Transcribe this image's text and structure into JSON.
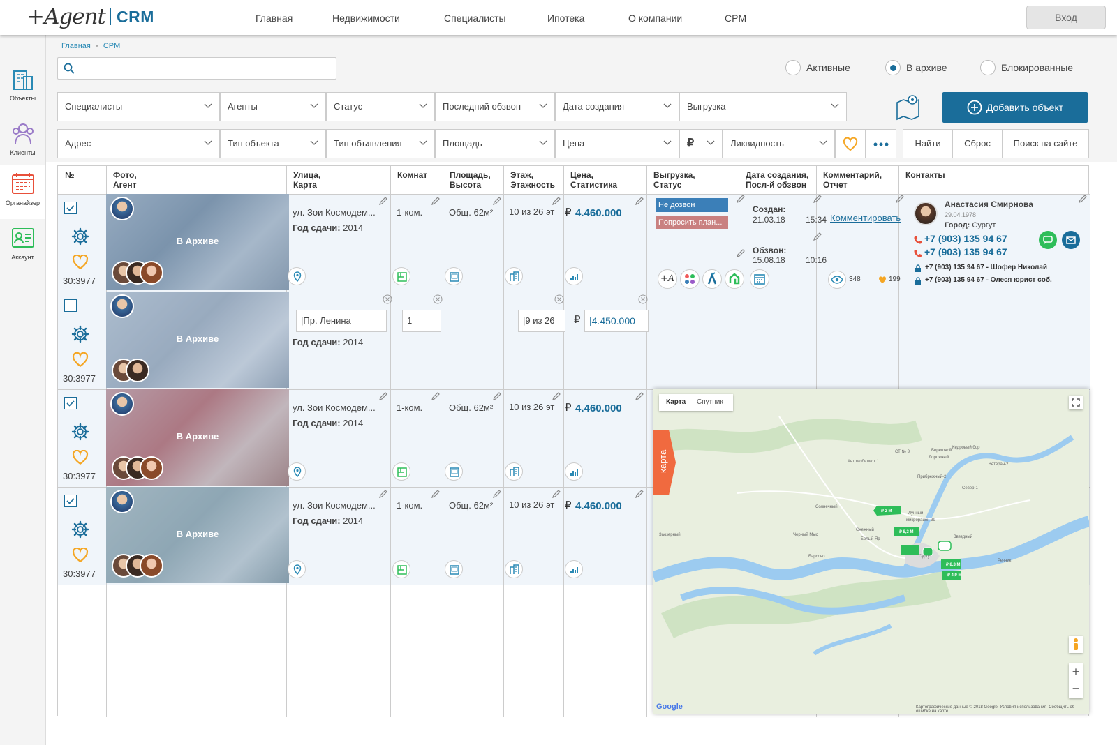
{
  "header": {
    "logo_text": "+Agent",
    "logo_crm": "CRM",
    "nav": [
      "Главная",
      "Недвижимости",
      "Специалисты",
      "Ипотека",
      "О компании",
      "CPM"
    ],
    "login": "Вход"
  },
  "sidebar": [
    {
      "label": "Объекты",
      "icon": "building-icon"
    },
    {
      "label": "Клиенты",
      "icon": "people-icon"
    },
    {
      "label": "Органайзер",
      "icon": "calendar-icon"
    },
    {
      "label": "Аккаунт",
      "icon": "account-icon"
    }
  ],
  "breadcrumb": {
    "home": "Главная",
    "sep": "•",
    "current": "CPM"
  },
  "search": {
    "placeholder": ""
  },
  "status_filter": {
    "options": [
      "Активные",
      "В архиве",
      "Блокированные"
    ],
    "selected": "В архиве"
  },
  "filters_row1": [
    "Специалисты",
    "Агенты",
    "Статус",
    "Последний обзвон",
    "Дата создания",
    "Выгрузка"
  ],
  "filters_row2": [
    "Адрес",
    "Тип объекта",
    "Тип объявления",
    "Площадь",
    "Цена",
    "₽",
    "Ликвидность"
  ],
  "actions": {
    "add": "Добавить объект",
    "find": "Найти",
    "reset": "Сброс",
    "site_search": "Поиск на сайте"
  },
  "table": {
    "headers": [
      [
        "№",
        ""
      ],
      [
        "Фото,",
        "Агент"
      ],
      [
        "Улица,",
        "Карта"
      ],
      [
        "Комнат",
        ""
      ],
      [
        "Площадь,",
        "Высота"
      ],
      [
        "Этаж,",
        "Этажность"
      ],
      [
        "Цена,",
        "Статистика"
      ],
      [
        "Выгрузка,",
        "Статус"
      ],
      [
        "Дата создания,",
        "Посл-й обзвон"
      ],
      [
        "Комментарий,",
        "Отчет"
      ],
      [
        "Контакты",
        ""
      ]
    ],
    "rows": [
      {
        "id": "30:3977",
        "checked": true,
        "photo_label": "В Архиве",
        "street": "ул. Зои Космодем...",
        "year_label": "Год сдачи:",
        "year": "2014",
        "rooms": "1-ком.",
        "area": "Общ. 62м²",
        "floor": "10 из 26 эт",
        "currency": "₽",
        "price": "4.460.000"
      },
      {
        "id": "30:3977",
        "checked": false,
        "photo_label": "В Архиве",
        "street_input": "|Пр. Ленина",
        "year_label": "Год сдачи:",
        "year": "2014",
        "rooms_input": "1",
        "floor_input": "|9 из 26",
        "currency": "₽",
        "price_input": "|4.450.000"
      },
      {
        "id": "30:3977",
        "checked": true,
        "photo_label": "В Архиве",
        "street": "ул. Зои Космодем...",
        "year_label": "Год сдачи:",
        "year": "2014",
        "rooms": "1-ком.",
        "area": "Общ. 62м²",
        "floor": "10 из 26 эт",
        "currency": "₽",
        "price": "4.460.000"
      },
      {
        "id": "30:3977",
        "checked": true,
        "photo_label": "В Архиве",
        "street": "ул. Зои Космодем...",
        "year_label": "Год сдачи:",
        "year": "2014",
        "rooms": "1-ком.",
        "area": "Общ. 62м²",
        "floor": "10 из 26 эт",
        "currency": "₽",
        "price": "4.460.000"
      }
    ],
    "row1_extra": {
      "status1": "Не дозвон",
      "status2": "Попросить план...",
      "created_label": "Создан:",
      "created_date": "21.03.18",
      "created_time": "15:34",
      "call_label": "Обзвон:",
      "call_date": "15.08.18",
      "call_time": "10:16",
      "comment_link": "Комментировать",
      "views": "348",
      "likes": "199",
      "contact": {
        "name": "Анастасия Смирнова",
        "dob": "29.04.1978",
        "city_label": "Город:",
        "city": "Сургут",
        "phone1": "+7 (903) 135 94 67",
        "phone2": "+7 (903) 135 94 67",
        "extra1": "+7 (903) 135 94 67 - Шофер Николай",
        "extra2": "+7 (903) 135 94 67 - Олеся юрист соб."
      }
    }
  },
  "map": {
    "tab_label": "карта",
    "type_map": "Карта",
    "type_sat": "Спутник",
    "google": "Google",
    "footer1": "Картографические данные © 2018 Google",
    "footer2": "Условия использования",
    "footer3": "Сообщить об ошибке на карте",
    "places": [
      "Солнечный",
      "Барсово",
      "Белый Яр",
      "Снежный",
      "Лунный",
      "микрорайон 39",
      "Сургут",
      "Черный Мыс",
      "Береговой",
      "Дорожный",
      "Кедровый бор",
      "Прибрежный-2",
      "Ветеран-2",
      "Север-1",
      "Звездный",
      "Речник",
      "Автомобилист 1",
      "СТ № 3",
      "Заозерный"
    ],
    "markers": [
      "₽ 2 М",
      "₽ 8,3 М",
      "₽ 8,3 М",
      "₽ 4,9 М"
    ]
  },
  "colors": {
    "brand": "#1a6d9a",
    "accent": "#2a8ab5",
    "tab": "#f06a3f",
    "tag_blue": "#3b7fb8",
    "tag_red": "#c98080",
    "heart": "#f5a623",
    "green": "#2ebd59"
  }
}
